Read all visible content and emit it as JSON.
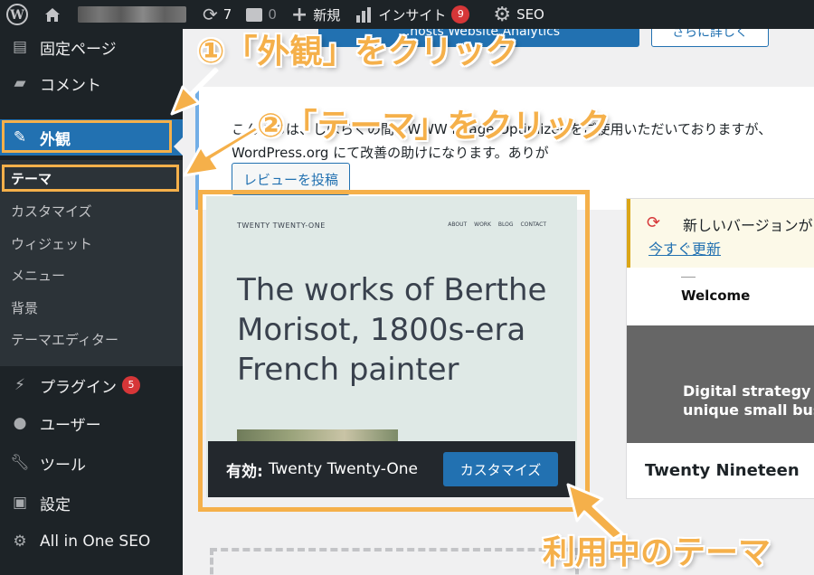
{
  "adminbar": {
    "updates_count": "7",
    "comments_count": "0",
    "new_label": "新規",
    "insight_label": "インサイト",
    "insight_badge": "9",
    "seo_label": "SEO"
  },
  "sidebar": {
    "fixed_page": "固定ページ",
    "comments": "コメント",
    "appearance": "外観",
    "submenu": [
      "テーマ",
      "カスタマイズ",
      "ウィジェット",
      "メニュー",
      "背景",
      "テーマエディター"
    ],
    "plugins": "プラグイン",
    "plugins_badge": "5",
    "users": "ユーザー",
    "tools": "ツール",
    "settings": "設定",
    "aioseo": "All in One SEO"
  },
  "notice": {
    "line1": "こんにちは、しばらくの間 EWWW Image Optimizer をご使用いただいておりますが、",
    "line2": "WordPress.org にて改善の助けになります。ありが",
    "review_button": "レビューを投稿"
  },
  "top_buttons": {
    "blue_fragment": "...hosts Website Analytics",
    "outline_fragment": "さらに詳しく"
  },
  "active_theme": {
    "preview_site_title": "TWENTY TWENTY-ONE",
    "preview_nav": [
      "ABOUT",
      "WORK",
      "BLOG",
      "CONTACT"
    ],
    "preview_heading": "The works of Berthe Morisot, 1800s-era French painter",
    "status_label": "有効:",
    "name": "Twenty Twenty-One",
    "customize_button": "カスタマイズ"
  },
  "second_theme": {
    "update_text": "新しいバージョンが",
    "update_link": "今すぐ更新",
    "preview_welcome": "Welcome",
    "preview_dark_text_1": "Digital strategy for",
    "preview_dark_text_2": "unique small busine",
    "name": "Twenty Nineteen"
  },
  "annotations": {
    "step1": "①「外観」をクリック",
    "step2": "②「テーマ」をクリック",
    "current_theme": "利用中のテーマ"
  },
  "colors": {
    "admin_dark": "#1d2327",
    "wp_blue": "#2271b1",
    "annotation_orange": "#f5b04a",
    "badge_red": "#d63638"
  }
}
